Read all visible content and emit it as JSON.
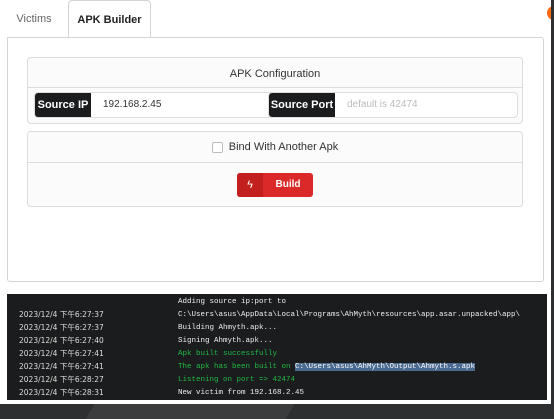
{
  "tabs": [
    {
      "label": "Victims",
      "active": false
    },
    {
      "label": "APK Builder",
      "active": true
    }
  ],
  "window_controls": {
    "colors": [
      "#ff6a13",
      "#e51b1b"
    ]
  },
  "apk_config": {
    "title": "APK Configuration",
    "source_ip": {
      "label": "Source IP",
      "value": "192.168.2.45"
    },
    "source_port": {
      "label": "Source Port",
      "placeholder": "default is 42474",
      "value": ""
    }
  },
  "bind": {
    "label": "Bind With Another Apk",
    "checked": false
  },
  "build": {
    "label": "Build",
    "icon": "bolt-icon",
    "color": "#db2828"
  },
  "log": [
    {
      "time": "",
      "message": "Adding source ip:port to",
      "status": "info"
    },
    {
      "time": "2023/12/4 下午6:27:37",
      "message": "C:\\Users\\asus\\AppData\\Local\\Programs\\AhMyth\\resources\\app.asar.unpacked\\app\\",
      "status": "info"
    },
    {
      "time": "2023/12/4 下午6:27:37",
      "message": "Building Ahmyth.apk...",
      "status": "info"
    },
    {
      "time": "2023/12/4 下午6:27:40",
      "message": "Signing Ahmyth.apk...",
      "status": "info"
    },
    {
      "time": "2023/12/4 下午6:27:41",
      "message": "Apk built successfully",
      "status": "success"
    },
    {
      "time": "2023/12/4 下午6:27:41",
      "message": "The apk has been built on ",
      "path": "C:\\Users\\asus\\AhMyth\\Output\\Ahmyth.s.apk",
      "status": "success"
    },
    {
      "time": "2023/12/4 下午6:28:27",
      "message": "Listening on port => 42474",
      "status": "success"
    },
    {
      "time": "2023/12/4 下午6:28:31",
      "message": "New victim from 192.168.2.45",
      "status": "info"
    }
  ]
}
